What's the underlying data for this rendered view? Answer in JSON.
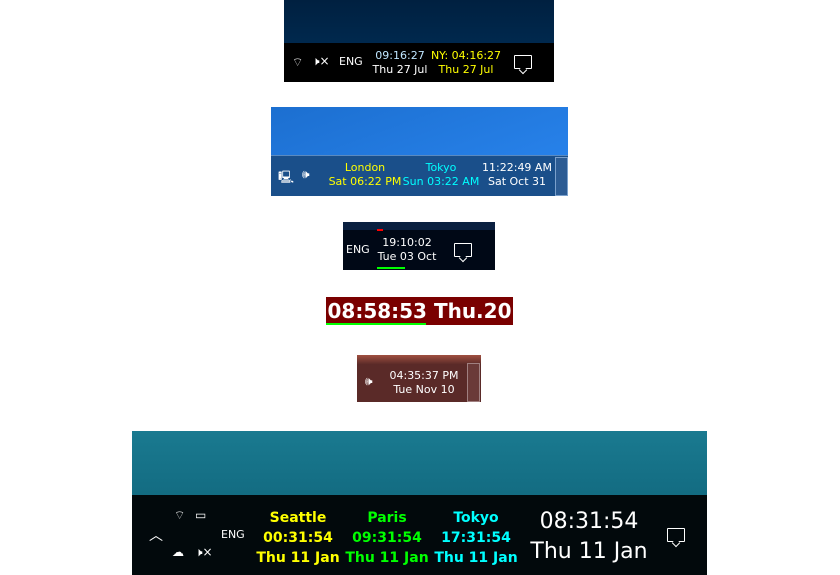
{
  "colors": {
    "yellow": "#ffff00",
    "green": "#00ff00",
    "cyan": "#00ffff",
    "light_blue": "#bfe6ff",
    "dark_red": "#7a0000"
  },
  "p1": {
    "lang": "ENG",
    "local_time": "09:16:27",
    "local_date": "Thu 27 Jul",
    "ny_time": "NY: 04:16:27",
    "ny_date": "Thu 27 Jul"
  },
  "p2": {
    "london_label": "London",
    "london_time": "Sat 06:22 PM",
    "tokyo_label": "Tokyo",
    "tokyo_time": "Sun 03:22 AM",
    "local_time": "11:22:49 AM",
    "local_date": "Sat Oct 31"
  },
  "p3": {
    "lang": "ENG",
    "time": "19:10:02",
    "date": "Tue 03 Oct"
  },
  "p4": {
    "clock": "08:58:53 Thu.20"
  },
  "p5": {
    "time": "04:35:37 PM",
    "date": "Tue Nov 10"
  },
  "p6": {
    "lang": "ENG",
    "clocks": [
      {
        "city": "Seattle",
        "time": "00:31:54",
        "date": "Thu 11 Jan",
        "color": "#ffff00"
      },
      {
        "city": "Paris",
        "time": "09:31:54",
        "date": "Thu 11 Jan",
        "color": "#00ff00"
      },
      {
        "city": "Tokyo",
        "time": "17:31:54",
        "date": "Thu 11 Jan",
        "color": "#00ffff"
      }
    ],
    "local_time": "08:31:54",
    "local_date": "Thu 11 Jan"
  }
}
